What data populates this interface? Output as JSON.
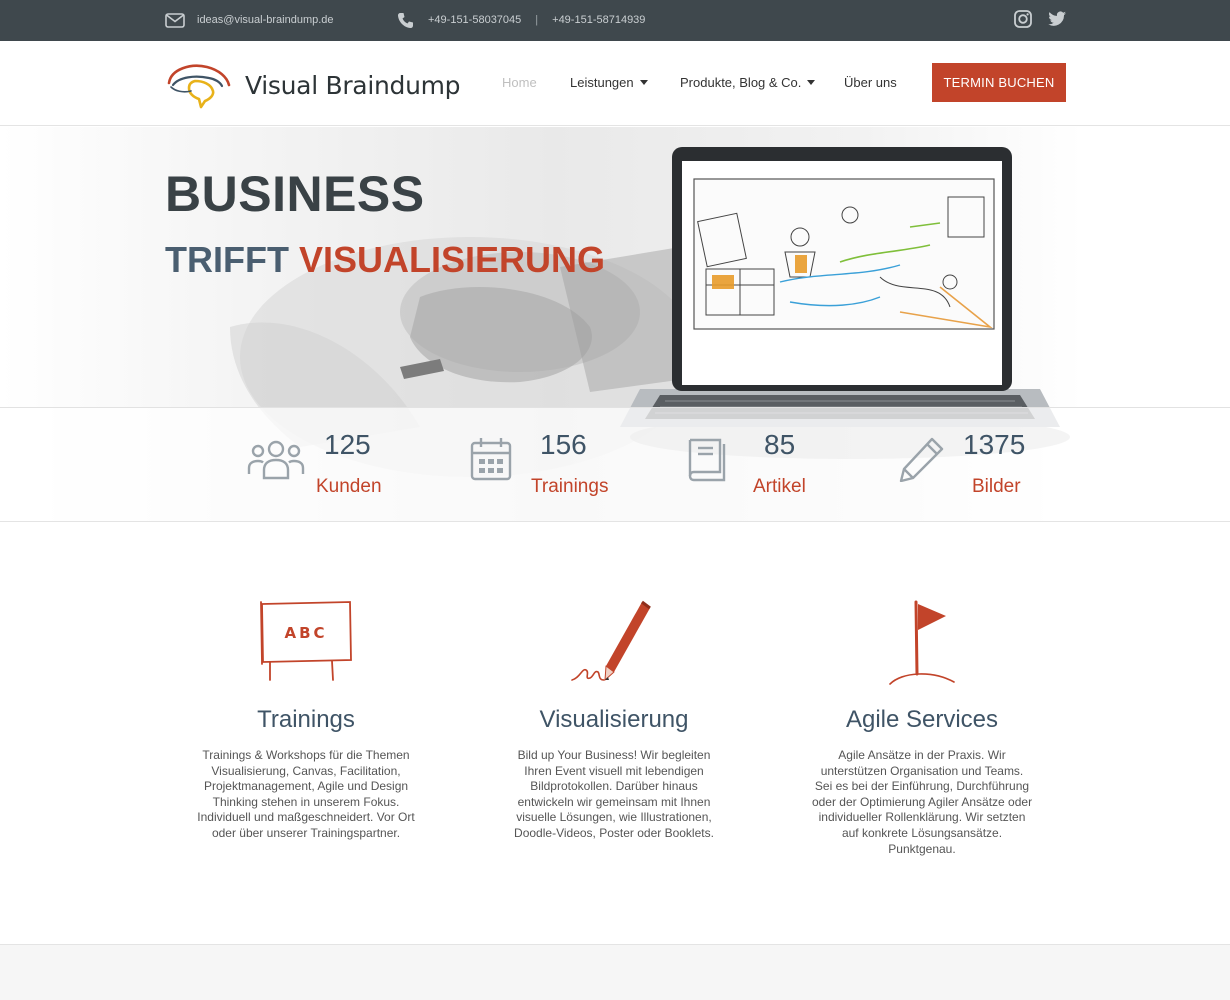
{
  "topbar": {
    "email": "ideas@visual-braindump.de",
    "phone_1": "+49-151-58037045",
    "separator": "|",
    "phone_2": "+49-151-58714939",
    "icons": [
      "mail-icon",
      "phone-icon",
      "instagram-icon",
      "twitter-icon"
    ]
  },
  "header": {
    "logo_text": "Visual Braindump",
    "nav": {
      "home": "Home",
      "leistungen": "Leistungen",
      "produkte": "Produkte, Blog & Co.",
      "ueber": "Über uns"
    },
    "cta": "TERMIN BUCHEN"
  },
  "hero": {
    "title": "BUSINESS",
    "subtitle_part1": "TRIFFT",
    "subtitle_part2": "VISUALISIERUNG"
  },
  "stats": [
    {
      "value": "125",
      "label": "Kunden",
      "icon": "people-icon"
    },
    {
      "value": "156",
      "label": "Trainings",
      "icon": "calendar-icon"
    },
    {
      "value": "85",
      "label": "Artikel",
      "icon": "book-icon"
    },
    {
      "value": "1375",
      "label": "Bilder",
      "icon": "pencil-icon"
    }
  ],
  "services": [
    {
      "title": "Trainings",
      "icon": "abc-board-icon",
      "text": "Trainings & Workshops für die Themen Visualisierung, Canvas, Facilitation, Projektmanagement, Agile und Design Thinking stehen in unserem Fokus. Individuell und maßgeschneidert. Vor Ort oder über unserer Trainingspartner."
    },
    {
      "title": "Visualisierung",
      "icon": "drawing-pencil-icon",
      "text": "Bild up Your Business! Wir begleiten Ihren Event visuell mit lebendigen Bildprotokollen. Darüber hinaus entwickeln wir gemeinsam mit Ihnen visuelle Lösungen, wie Illustrationen, Doodle-Videos, Poster oder Booklets."
    },
    {
      "title": "Agile Services",
      "icon": "flag-icon",
      "text": "Agile Ansätze in der Praxis. Wir unterstützen Organisation und Teams. Sei es bei der Einführung, Durchführung oder der Optimierung Agiler Ansätze oder individueller Rollenklärung. Wir setzten auf konkrete Lösungsansätze. Punktgenau."
    }
  ],
  "colors": {
    "accent": "#c2442a",
    "topbar": "#3f484d",
    "heading_blue": "#3f5466"
  }
}
